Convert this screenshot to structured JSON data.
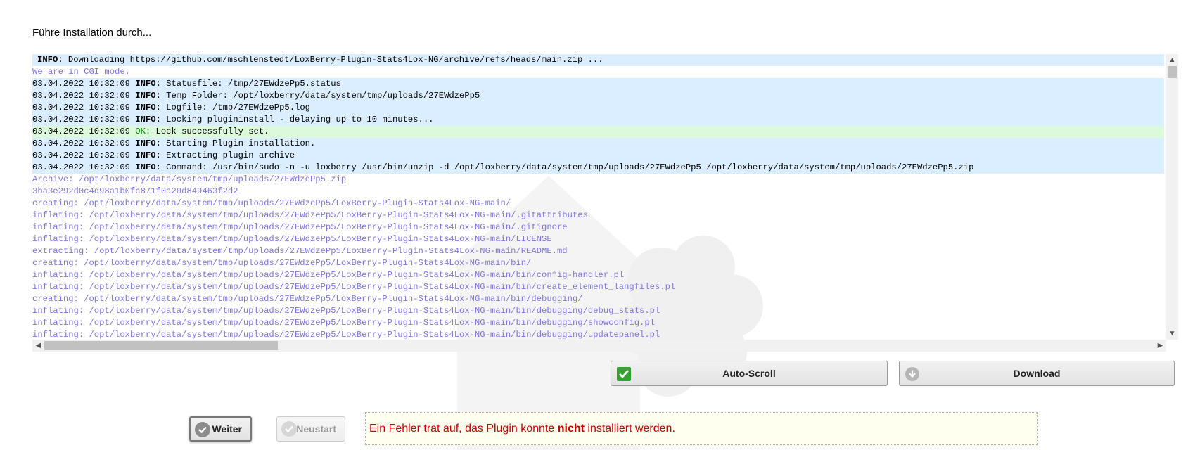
{
  "heading": "Führe Installation durch...",
  "log_lines": [
    {
      "kind": "info",
      "ts": "",
      "level": "INFO:",
      "msg": " Downloading https://github.com/mschlenstedt/LoxBerry-Plugin-Stats4Lox-NG/archive/refs/heads/main.zip ..."
    },
    {
      "kind": "plain",
      "text": "We are in CGI mode."
    },
    {
      "kind": "info",
      "ts": "03.04.2022 10:32:09 ",
      "level": "INFO:",
      "msg": " Statusfile: /tmp/27EWdzePp5.status"
    },
    {
      "kind": "info",
      "ts": "03.04.2022 10:32:09 ",
      "level": "INFO:",
      "msg": " Temp Folder: /opt/loxberry/data/system/tmp/uploads/27EWdzePp5"
    },
    {
      "kind": "info",
      "ts": "03.04.2022 10:32:09 ",
      "level": "INFO:",
      "msg": " Logfile: /tmp/27EWdzePp5.log"
    },
    {
      "kind": "info",
      "ts": "03.04.2022 10:32:09 ",
      "level": "INFO:",
      "msg": " Locking plugininstall - delaying up to 10 minutes..."
    },
    {
      "kind": "ok",
      "ts": "03.04.2022 10:32:09 ",
      "level": "OK:",
      "msg": " Lock successfully set."
    },
    {
      "kind": "info",
      "ts": "03.04.2022 10:32:09 ",
      "level": "INFO:",
      "msg": " Starting Plugin installation."
    },
    {
      "kind": "info",
      "ts": "03.04.2022 10:32:09 ",
      "level": "INFO:",
      "msg": " Extracting plugin archive"
    },
    {
      "kind": "info",
      "ts": "03.04.2022 10:32:09 ",
      "level": "INFO:",
      "msg": " Command: /usr/bin/sudo -n -u loxberry /usr/bin/unzip -d /opt/loxberry/data/system/tmp/uploads/27EWdzePp5 /opt/loxberry/data/system/tmp/uploads/27EWdzePp5.zip"
    },
    {
      "kind": "plain",
      "text": "Archive: /opt/loxberry/data/system/tmp/uploads/27EWdzePp5.zip"
    },
    {
      "kind": "plain",
      "text": "3ba3e292d0c4d98a1b0fc871f0a20d849463f2d2"
    },
    {
      "kind": "plain",
      "text": "creating: /opt/loxberry/data/system/tmp/uploads/27EWdzePp5/LoxBerry-Plugin-Stats4Lox-NG-main/"
    },
    {
      "kind": "plain",
      "text": "inflating: /opt/loxberry/data/system/tmp/uploads/27EWdzePp5/LoxBerry-Plugin-Stats4Lox-NG-main/.gitattributes"
    },
    {
      "kind": "plain",
      "text": "inflating: /opt/loxberry/data/system/tmp/uploads/27EWdzePp5/LoxBerry-Plugin-Stats4Lox-NG-main/.gitignore"
    },
    {
      "kind": "plain",
      "text": "inflating: /opt/loxberry/data/system/tmp/uploads/27EWdzePp5/LoxBerry-Plugin-Stats4Lox-NG-main/LICENSE"
    },
    {
      "kind": "plain",
      "text": "extracting: /opt/loxberry/data/system/tmp/uploads/27EWdzePp5/LoxBerry-Plugin-Stats4Lox-NG-main/README.md"
    },
    {
      "kind": "plain",
      "text": "creating: /opt/loxberry/data/system/tmp/uploads/27EWdzePp5/LoxBerry-Plugin-Stats4Lox-NG-main/bin/"
    },
    {
      "kind": "plain",
      "text": "inflating: /opt/loxberry/data/system/tmp/uploads/27EWdzePp5/LoxBerry-Plugin-Stats4Lox-NG-main/bin/config-handler.pl"
    },
    {
      "kind": "plain",
      "text": "inflating: /opt/loxberry/data/system/tmp/uploads/27EWdzePp5/LoxBerry-Plugin-Stats4Lox-NG-main/bin/create_element_langfiles.pl"
    },
    {
      "kind": "plain",
      "text": "creating: /opt/loxberry/data/system/tmp/uploads/27EWdzePp5/LoxBerry-Plugin-Stats4Lox-NG-main/bin/debugging/"
    },
    {
      "kind": "plain",
      "text": "inflating: /opt/loxberry/data/system/tmp/uploads/27EWdzePp5/LoxBerry-Plugin-Stats4Lox-NG-main/bin/debugging/debug_stats.pl"
    },
    {
      "kind": "plain",
      "text": "inflating: /opt/loxberry/data/system/tmp/uploads/27EWdzePp5/LoxBerry-Plugin-Stats4Lox-NG-main/bin/debugging/showconfig.pl"
    },
    {
      "kind": "plain",
      "text": "inflating: /opt/loxberry/data/system/tmp/uploads/27EWdzePp5/LoxBerry-Plugin-Stats4Lox-NG-main/bin/debugging/updatepanel.pl"
    }
  ],
  "buttons": {
    "autoscroll": "Auto-Scroll",
    "download": "Download",
    "weiter": "Weiter",
    "neustart": "Neustart"
  },
  "icons": {
    "autoscroll": "checkbox-checked-icon",
    "download": "download-icon",
    "weiter": "check-icon",
    "neustart": "check-icon"
  },
  "error": {
    "before": "Ein Fehler trat auf, das Plugin konnte ",
    "emphasis": "nicht",
    "after": " installiert werden."
  },
  "colors": {
    "info_bg": "#dbeeff",
    "ok_bg": "#dcf9dc",
    "plain_text": "#7f77dd",
    "ok_level": "#008800",
    "error_text": "#cc0000",
    "error_bg": "#fffff0"
  }
}
